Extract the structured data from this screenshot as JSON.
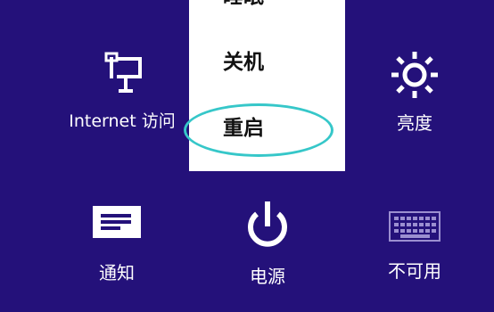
{
  "settings": {
    "internet_label": "Internet 访问",
    "brightness_label": "亮度",
    "notifications_label": "通知",
    "power_label": "电源",
    "keyboard_label": "不可用"
  },
  "power_menu": {
    "items": [
      {
        "label": "睡眠"
      },
      {
        "label": "关机"
      },
      {
        "label": "重启"
      }
    ]
  },
  "icons": {
    "internet": "network-icon",
    "brightness": "brightness-sun-icon",
    "notifications": "notifications-icon",
    "power": "power-icon",
    "keyboard": "keyboard-icon"
  },
  "colors": {
    "background": "#24117a",
    "menu_background": "#ffffff",
    "highlight": "#36c7c9",
    "text": "#ffffff",
    "menu_text": "#111111"
  }
}
